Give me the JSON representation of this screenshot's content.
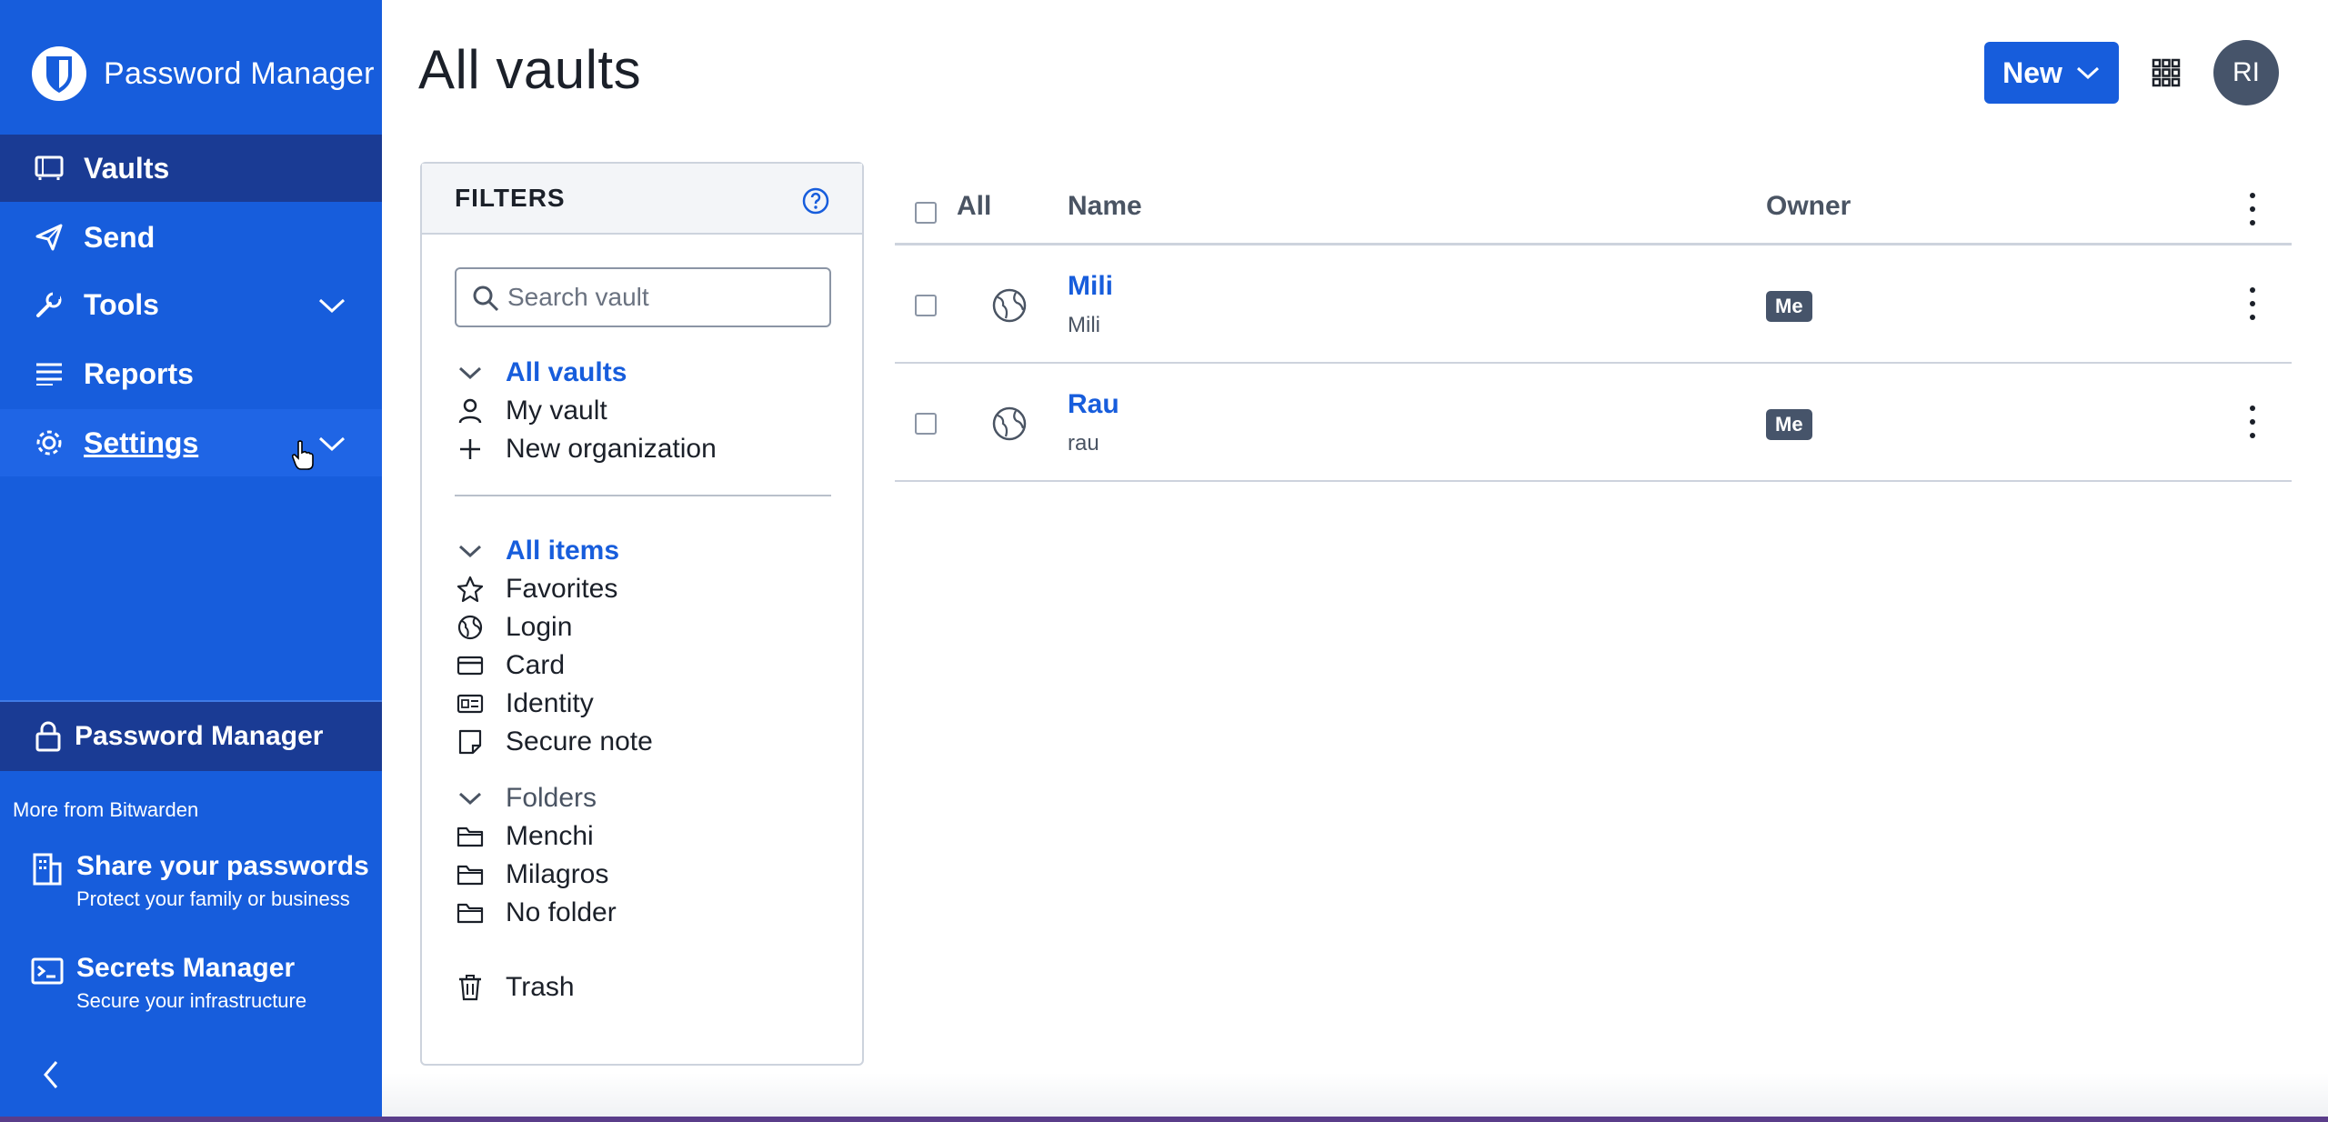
{
  "app": {
    "brand": "Password Manager",
    "page_title": "All vaults"
  },
  "colors": {
    "sidebar": "#175ddc",
    "sidebar_active": "#1a3b94",
    "accent": "#175ddc",
    "badge": "#46546a"
  },
  "sidebar": {
    "items": [
      {
        "label": "Vaults",
        "icon": "vault-icon"
      },
      {
        "label": "Send",
        "icon": "send-icon"
      },
      {
        "label": "Tools",
        "icon": "wrench-icon"
      },
      {
        "label": "Reports",
        "icon": "reports-icon"
      },
      {
        "label": "Settings",
        "icon": "gear-icon"
      }
    ],
    "product_bar": "Password Manager",
    "more_from": "More from Bitwarden",
    "products": [
      {
        "title": "Share your passwords",
        "subtitle": "Protect your family or business"
      },
      {
        "title": "Secrets Manager",
        "subtitle": "Secure your infrastructure"
      }
    ]
  },
  "header": {
    "new_label": "New",
    "avatar_initials": "RI"
  },
  "filters": {
    "title": "FILTERS",
    "search_placeholder": "Search vault",
    "vaults": {
      "heading": "All vaults",
      "items": [
        "My vault",
        "New organization"
      ]
    },
    "types": {
      "heading": "All items",
      "items": [
        "Favorites",
        "Login",
        "Card",
        "Identity",
        "Secure note"
      ]
    },
    "folders": {
      "heading": "Folders",
      "items": [
        "Menchi",
        "Milagros",
        "No folder"
      ]
    },
    "trash": "Trash"
  },
  "table": {
    "headers": {
      "all": "All",
      "name": "Name",
      "owner": "Owner"
    },
    "rows": [
      {
        "name": "Mili",
        "subtitle": "Mili",
        "owner": "Me"
      },
      {
        "name": "Rau",
        "subtitle": "rau",
        "owner": "Me"
      }
    ]
  }
}
